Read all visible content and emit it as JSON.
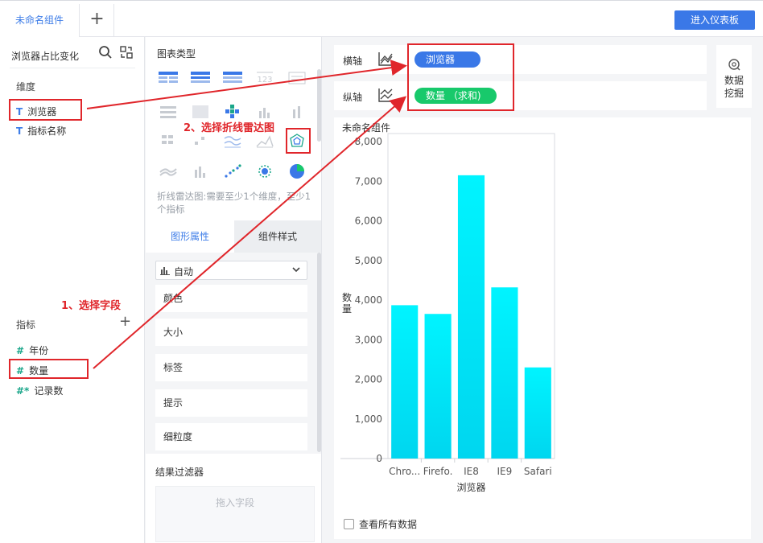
{
  "topbar": {
    "tab_label": "未命名组件",
    "add_tab": "+",
    "enter_dashboard": "进入仪表板"
  },
  "data_panel": {
    "dataset_title": "浏览器占比变化",
    "dimension_label": "维度",
    "dimensions": [
      {
        "type": "T",
        "name": "浏览器"
      },
      {
        "type": "T",
        "name": "指标名称"
      }
    ],
    "metric_label": "指标",
    "metric_add": "+",
    "metrics": [
      {
        "type": "#",
        "name": "年份"
      },
      {
        "type": "#",
        "name": "数量"
      },
      {
        "type": "#*",
        "name": "记录数"
      }
    ]
  },
  "chart_panel": {
    "title": "图表类型",
    "hint": "折线雷达图:需要至少1个维度，至少1个指标",
    "tabs": [
      "图形属性",
      "组件样式"
    ],
    "auto_select": "自动",
    "properties": [
      "颜色",
      "大小",
      "标签",
      "提示",
      "细粒度"
    ],
    "filter_title": "结果过滤器",
    "filter_drop": "拖入字段"
  },
  "axes": {
    "x_label": "横轴",
    "x_field": "浏览器",
    "y_label": "纵轴",
    "y_field": "数量 （求和)"
  },
  "mining": {
    "label_line1": "数据",
    "label_line2": "挖掘"
  },
  "chart_card": {
    "title": "未命名组件",
    "view_all": "查看所有数据"
  },
  "annotations": {
    "step1": "1、选择字段",
    "step2": "2、选择折线雷达图"
  },
  "colors": {
    "accent": "#3a78e7",
    "green_pill": "#18c96b",
    "bar_top": "#00f4ff",
    "bar_bottom": "#00d8f0",
    "annotation": "#e0262b"
  },
  "chart_data": {
    "type": "bar",
    "categories": [
      "Chro...",
      "Firefo.",
      "IE8",
      "IE9",
      "Safari"
    ],
    "values": [
      3870,
      3650,
      7150,
      4320,
      2300
    ],
    "xlabel": "浏览器",
    "ylabel": "数量",
    "ylim": [
      0,
      8000
    ],
    "yticks": [
      "0",
      "1,000",
      "2,000",
      "3,000",
      "4,000",
      "5,000",
      "6,000",
      "7,000",
      "8,000"
    ]
  }
}
